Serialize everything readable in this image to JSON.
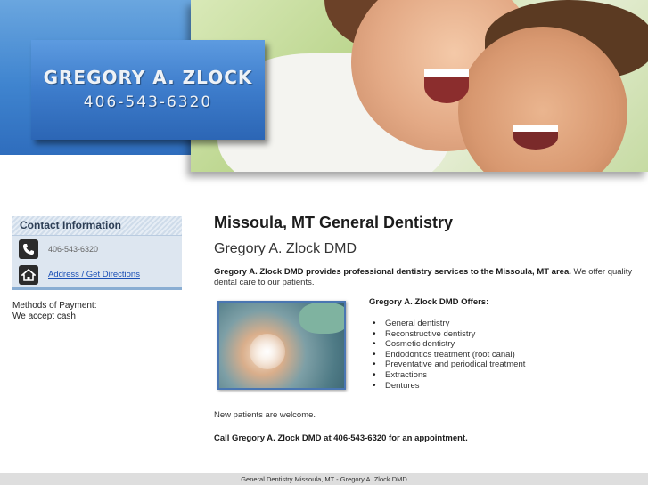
{
  "header": {
    "logo_name": "GREGORY A. ZLOCK",
    "logo_phone": "406-543-6320"
  },
  "sidebar": {
    "contact_heading": "Contact Information",
    "phone_text": "406-543-6320",
    "directions_link": "Address / Get Directions",
    "payment_label": "Methods of Payment:",
    "payment_value": "We accept cash",
    "phone_icon": "phone-icon",
    "home_icon": "home-icon"
  },
  "main": {
    "title": "Missoula, MT General Dentistry",
    "subtitle": "Gregory A. Zlock DMD",
    "intro_bold": "Gregory A. Zlock DMD provides professional dentistry services to the Missoula, MT area.",
    "intro_rest": " We offer quality dental care to our patients.",
    "offers_title": "Gregory A. Zlock DMD Offers:",
    "offers": [
      "General dentistry",
      "Reconstructive dentistry",
      "Cosmetic dentistry",
      "Endodontics treatment (root canal)",
      "Preventative and periodical treatment",
      "Extractions",
      "Dentures"
    ],
    "welcome": "New patients are welcome.",
    "call": "Call Gregory A. Zlock DMD at 406-543-6320 for an appointment."
  },
  "footer": {
    "text": "General Dentistry Missoula, MT - Gregory A. Zlock DMD"
  },
  "colors": {
    "header_blue": "#3f84cf",
    "link_blue": "#1a4fb5",
    "sidebar_bg": "#dde6f0",
    "footer_bg": "#dedede"
  }
}
